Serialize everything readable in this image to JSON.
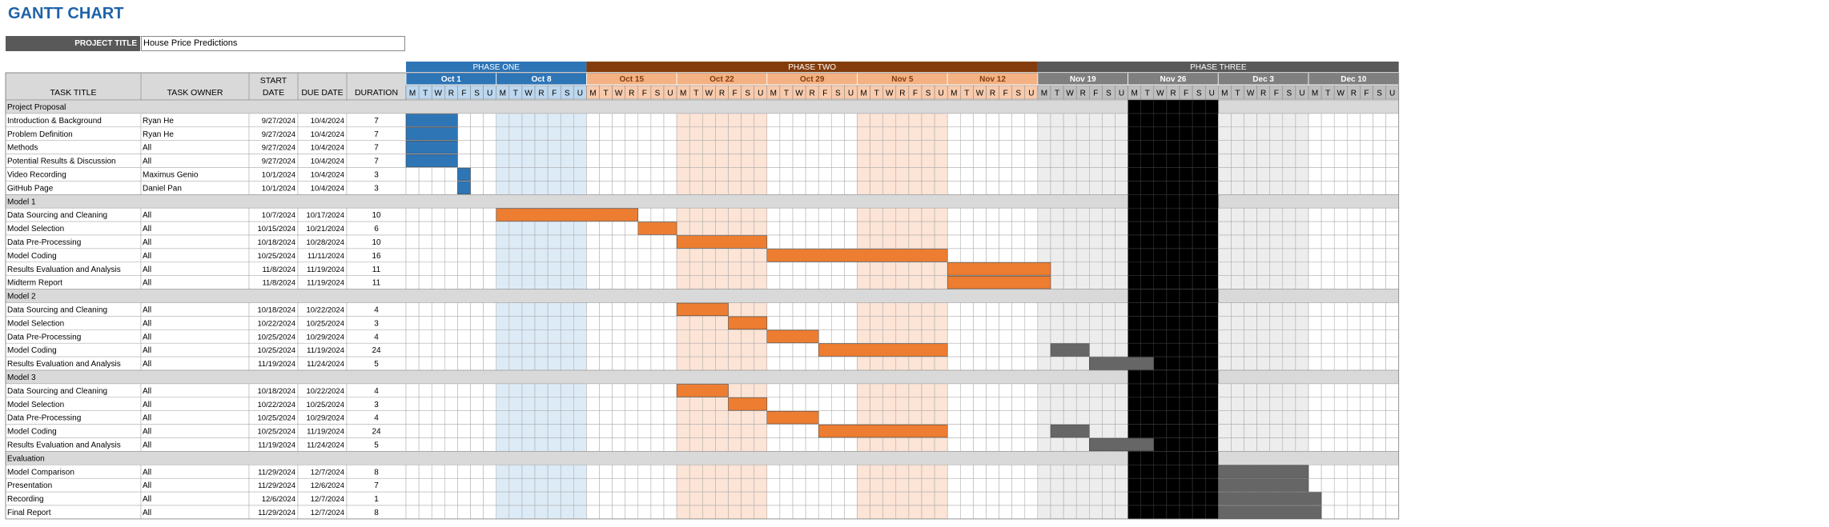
{
  "title": "GANTT CHART",
  "project": {
    "label": "PROJECT TITLE",
    "value": "House Price Predictions"
  },
  "columns": {
    "task": "TASK TITLE",
    "owner": "TASK OWNER",
    "start": "START DATE",
    "due": "DUE DATE",
    "duration": "DURATION"
  },
  "colors": {
    "blue": "#2e75b6",
    "orange": "#ed7d31",
    "gray": "#666666",
    "black": "#000000",
    "row_group": "#d9d9d9"
  },
  "phases": [
    {
      "label": "PHASE ONE",
      "weeks": 2,
      "color": "#2e75b6"
    },
    {
      "label": "PHASE TWO",
      "weeks": 5,
      "color": "#843c0c"
    },
    {
      "label": "PHASE THREE",
      "weeks": 4,
      "color": "#595959"
    }
  ],
  "weeks": [
    {
      "label": "Oct 1",
      "phase": 0
    },
    {
      "label": "Oct 8",
      "phase": 0
    },
    {
      "label": "Oct 15",
      "phase": 1
    },
    {
      "label": "Oct 22",
      "phase": 1
    },
    {
      "label": "Oct 29",
      "phase": 1
    },
    {
      "label": "Nov 5",
      "phase": 1
    },
    {
      "label": "Nov 12",
      "phase": 1
    },
    {
      "label": "Nov 19",
      "phase": 2
    },
    {
      "label": "Nov 26",
      "phase": 2
    },
    {
      "label": "Dec 3",
      "phase": 2
    },
    {
      "label": "Dec 10",
      "phase": 2
    }
  ],
  "day_letters": [
    "M",
    "T",
    "W",
    "R",
    "F",
    "S",
    "U"
  ],
  "rows": [
    {
      "group": true,
      "title": "Project Proposal"
    },
    {
      "title": "Introduction & Background",
      "owner": "Ryan He",
      "start": "9/27/2024",
      "due": "10/4/2024",
      "duration": "7",
      "bar_start": 0,
      "bar_days": 4,
      "color": "blue"
    },
    {
      "title": "Problem Definition",
      "owner": "Ryan He",
      "start": "9/27/2024",
      "due": "10/4/2024",
      "duration": "7",
      "bar_start": 0,
      "bar_days": 4,
      "color": "blue"
    },
    {
      "title": "Methods",
      "owner": "All",
      "start": "9/27/2024",
      "due": "10/4/2024",
      "duration": "7",
      "bar_start": 0,
      "bar_days": 4,
      "color": "blue"
    },
    {
      "title": "Potential Results & Discussion",
      "owner": "All",
      "start": "9/27/2024",
      "due": "10/4/2024",
      "duration": "7",
      "bar_start": 0,
      "bar_days": 4,
      "color": "blue"
    },
    {
      "title": "Video Recording",
      "owner": "Maximus Genio",
      "start": "10/1/2024",
      "due": "10/4/2024",
      "duration": "3",
      "bar_start": 4,
      "bar_days": 1,
      "color": "blue"
    },
    {
      "title": "GitHub Page",
      "owner": "Daniel Pan",
      "start": "10/1/2024",
      "due": "10/4/2024",
      "duration": "3",
      "bar_start": 4,
      "bar_days": 1,
      "color": "blue"
    },
    {
      "group": true,
      "title": "Model 1"
    },
    {
      "title": "Data Sourcing and Cleaning",
      "owner": "All",
      "start": "10/7/2024",
      "due": "10/17/2024",
      "duration": "10",
      "bar_start": 7,
      "bar_days": 11,
      "color": "orange"
    },
    {
      "title": "Model Selection",
      "owner": "All",
      "start": "10/15/2024",
      "due": "10/21/2024",
      "duration": "6",
      "bar_start": 18,
      "bar_days": 3,
      "color": "orange"
    },
    {
      "title": "Data Pre-Processing",
      "owner": "All",
      "start": "10/18/2024",
      "due": "10/28/2024",
      "duration": "10",
      "bar_start": 21,
      "bar_days": 7,
      "color": "orange"
    },
    {
      "title": "Model Coding",
      "owner": "All",
      "start": "10/25/2024",
      "due": "11/11/2024",
      "duration": "16",
      "bar_start": 28,
      "bar_days": 14,
      "color": "orange"
    },
    {
      "title": "Results Evaluation and Analysis",
      "owner": "All",
      "start": "11/8/2024",
      "due": "11/19/2024",
      "duration": "11",
      "bar_start": 42,
      "bar_days": 8,
      "color": "orange"
    },
    {
      "title": "Midterm Report",
      "owner": "All",
      "start": "11/8/2024",
      "due": "11/19/2024",
      "duration": "11",
      "bar_start": 42,
      "bar_days": 8,
      "color": "orange"
    },
    {
      "group": true,
      "title": "Model 2"
    },
    {
      "title": "Data Sourcing and Cleaning",
      "owner": "All",
      "start": "10/18/2024",
      "due": "10/22/2024",
      "duration": "4",
      "bar_start": 21,
      "bar_days": 4,
      "color": "orange"
    },
    {
      "title": "Model Selection",
      "owner": "All",
      "start": "10/22/2024",
      "due": "10/25/2024",
      "duration": "3",
      "bar_start": 25,
      "bar_days": 3,
      "color": "orange"
    },
    {
      "title": "Data Pre-Processing",
      "owner": "All",
      "start": "10/25/2024",
      "due": "10/29/2024",
      "duration": "4",
      "bar_start": 28,
      "bar_days": 4,
      "color": "orange"
    },
    {
      "title": "Model Coding",
      "owner": "All",
      "start": "10/25/2024",
      "due": "11/19/2024",
      "duration": "24",
      "bar_start": 32,
      "bar_days": 10,
      "color": "orange",
      "bar2_start": 50,
      "bar2_days": 3,
      "color2": "gray"
    },
    {
      "title": "Results Evaluation and Analysis",
      "owner": "All",
      "start": "11/19/2024",
      "due": "11/24/2024",
      "duration": "5",
      "bar_start": 53,
      "bar_days": 5,
      "color": "gray"
    },
    {
      "group": true,
      "title": "Model 3"
    },
    {
      "title": "Data Sourcing and Cleaning",
      "owner": "All",
      "start": "10/18/2024",
      "due": "10/22/2024",
      "duration": "4",
      "bar_start": 21,
      "bar_days": 4,
      "color": "orange"
    },
    {
      "title": "Model Selection",
      "owner": "All",
      "start": "10/22/2024",
      "due": "10/25/2024",
      "duration": "3",
      "bar_start": 25,
      "bar_days": 3,
      "color": "orange"
    },
    {
      "title": "Data Pre-Processing",
      "owner": "All",
      "start": "10/25/2024",
      "due": "10/29/2024",
      "duration": "4",
      "bar_start": 28,
      "bar_days": 4,
      "color": "orange"
    },
    {
      "title": "Model Coding",
      "owner": "All",
      "start": "10/25/2024",
      "due": "11/19/2024",
      "duration": "24",
      "bar_start": 32,
      "bar_days": 10,
      "color": "orange",
      "bar2_start": 50,
      "bar2_days": 3,
      "color2": "gray"
    },
    {
      "title": "Results Evaluation and Analysis",
      "owner": "All",
      "start": "11/19/2024",
      "due": "11/24/2024",
      "duration": "5",
      "bar_start": 53,
      "bar_days": 5,
      "color": "gray"
    },
    {
      "group": true,
      "title": "Evaluation"
    },
    {
      "title": "Model Comparison",
      "owner": "All",
      "start": "11/29/2024",
      "due": "12/7/2024",
      "duration": "8",
      "bar_start": 63,
      "bar_days": 7,
      "color": "gray"
    },
    {
      "title": "Presentation",
      "owner": "All",
      "start": "11/29/2024",
      "due": "12/6/2024",
      "duration": "7",
      "bar_start": 63,
      "bar_days": 7,
      "color": "gray"
    },
    {
      "title": "Recording",
      "owner": "All",
      "start": "12/6/2024",
      "due": "12/7/2024",
      "duration": "1",
      "bar_start": 63,
      "bar_days": 8,
      "color": "gray"
    },
    {
      "title": "Final Report",
      "owner": "All",
      "start": "11/29/2024",
      "due": "12/7/2024",
      "duration": "8",
      "bar_start": 63,
      "bar_days": 8,
      "color": "gray"
    }
  ]
}
